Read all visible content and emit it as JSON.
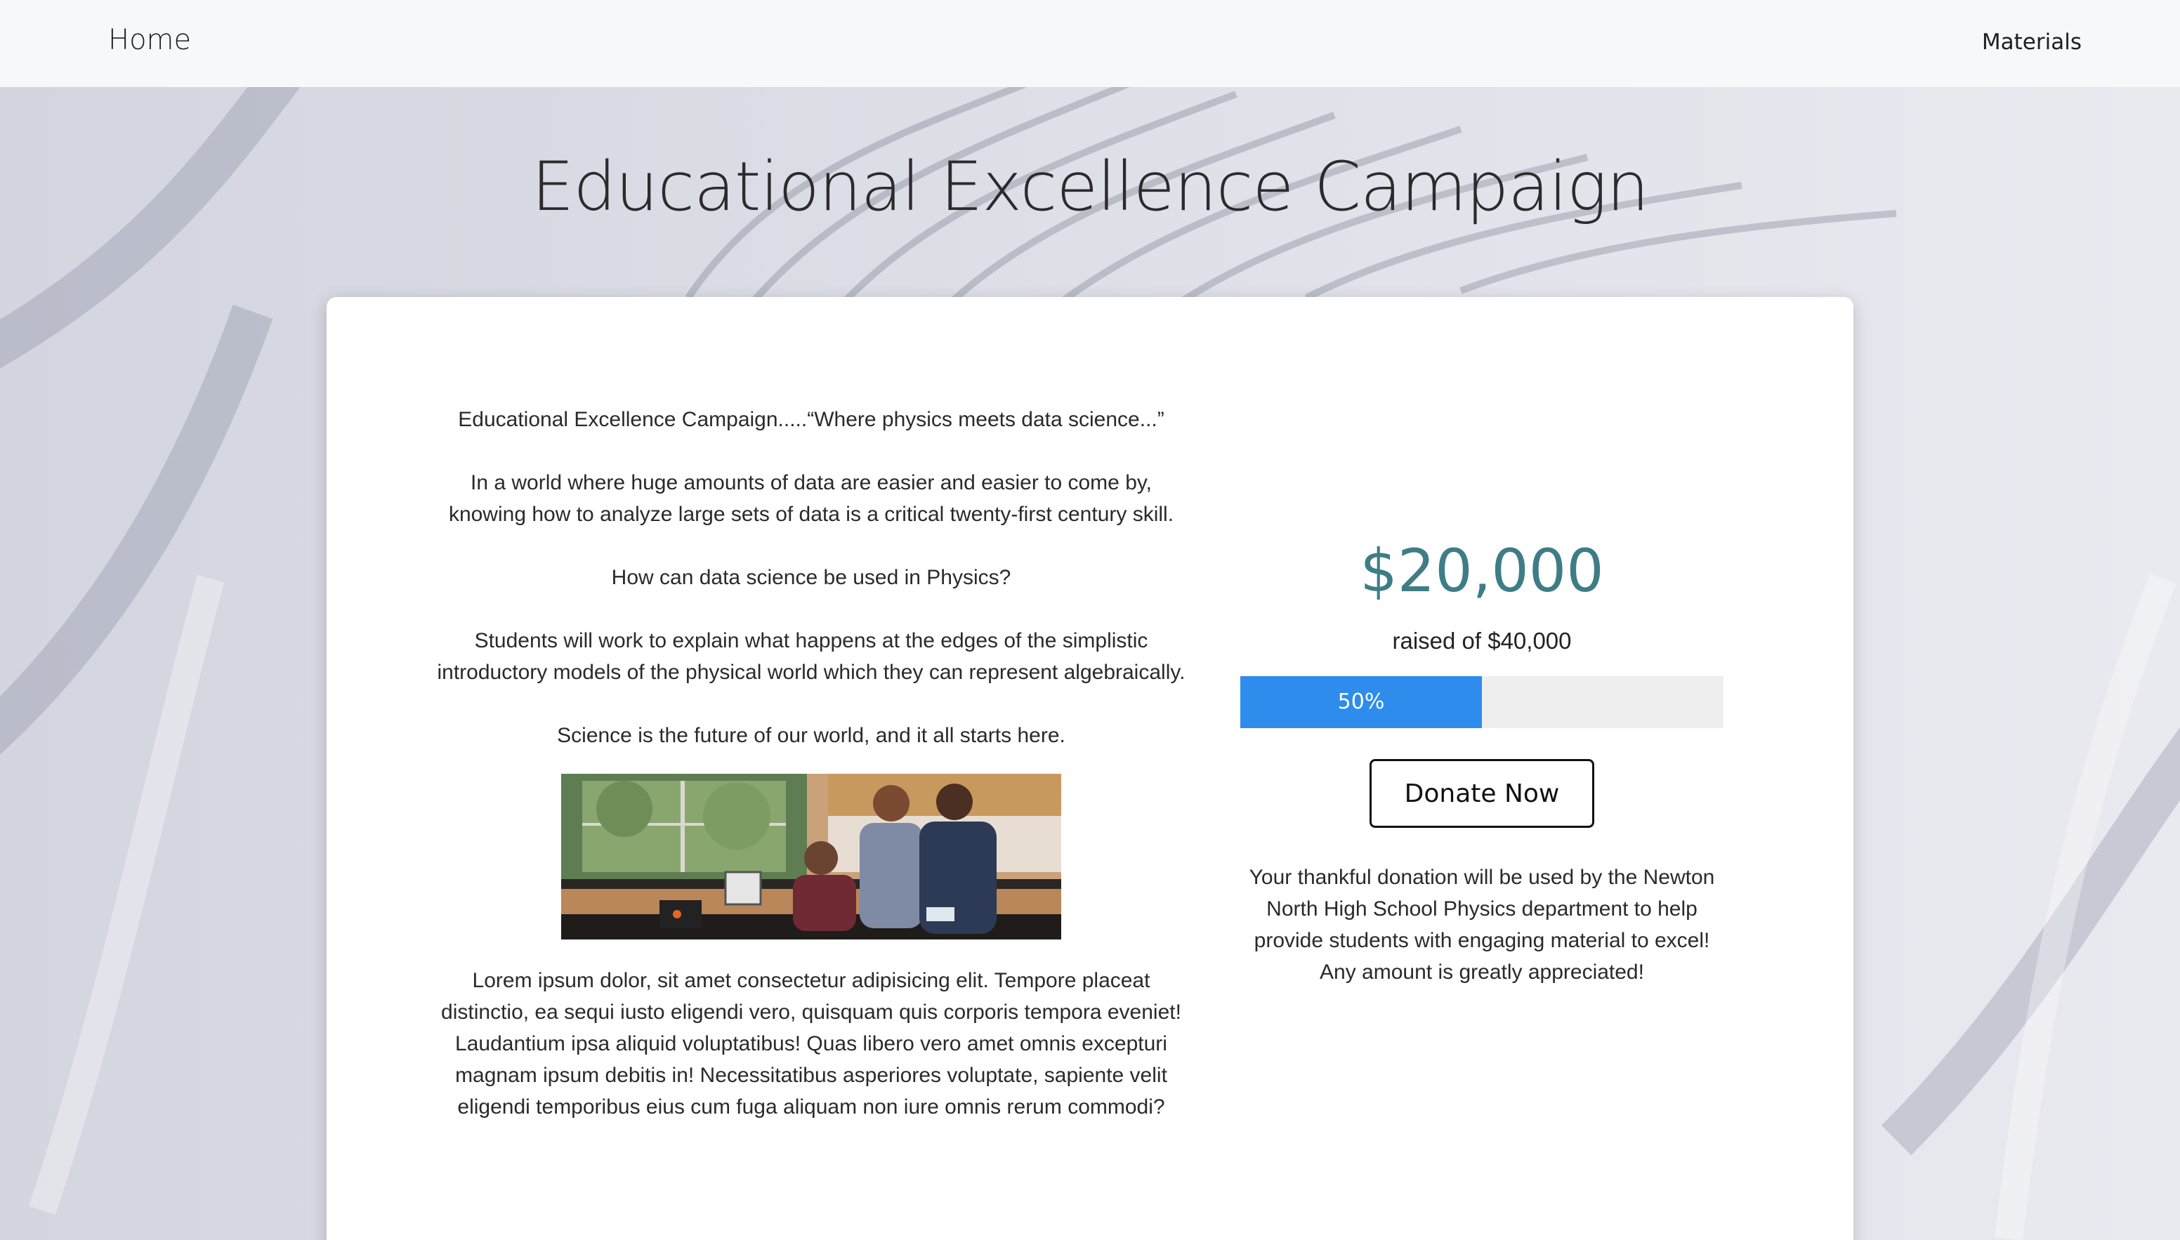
{
  "nav": {
    "home_label": "Home",
    "materials_label": "Materials"
  },
  "page": {
    "title": "Educational Excellence Campaign"
  },
  "story": {
    "paragraphs": [
      "Educational Excellence Campaign.....“Where physics meets data science...”",
      "In a world where huge amounts of data are easier and easier to come by, knowing how to analyze large sets of data is a critical twenty-first century skill.",
      "How can data science be used in Physics?",
      "Students will work to explain what happens at the edges of the simplistic introductory models of the physical world which they can represent algebraically.",
      "Science is the future of our world, and it all starts here."
    ],
    "image_description_icon": "classroom-photo",
    "body": "Lorem ipsum dolor, sit amet consectetur adipisicing elit. Tempore placeat distinctio, ea sequi iusto eligendi vero, quisquam quis corporis tempora eveniet! Laudantium ipsa aliquid voluptatibus! Quas libero vero amet omnis excepturi magnam ipsum debitis in! Necessitatibus asperiores voluptate, sapiente velit eligendi temporibus eius cum fuga aliquam non iure omnis rerum commodi?"
  },
  "fundraiser": {
    "raised": "$20,000",
    "goal_text": "raised of $40,000",
    "progress_fraction": 0.5,
    "progress_label": "50%",
    "progress_color": "#2d8cec",
    "amount_color": "#3f7d86",
    "donate_label": "Donate Now",
    "note": "Your thankful donation will be used by the Newton North High School Physics department to help provide students with engaging material to excel! Any amount is greatly appreciated!"
  }
}
